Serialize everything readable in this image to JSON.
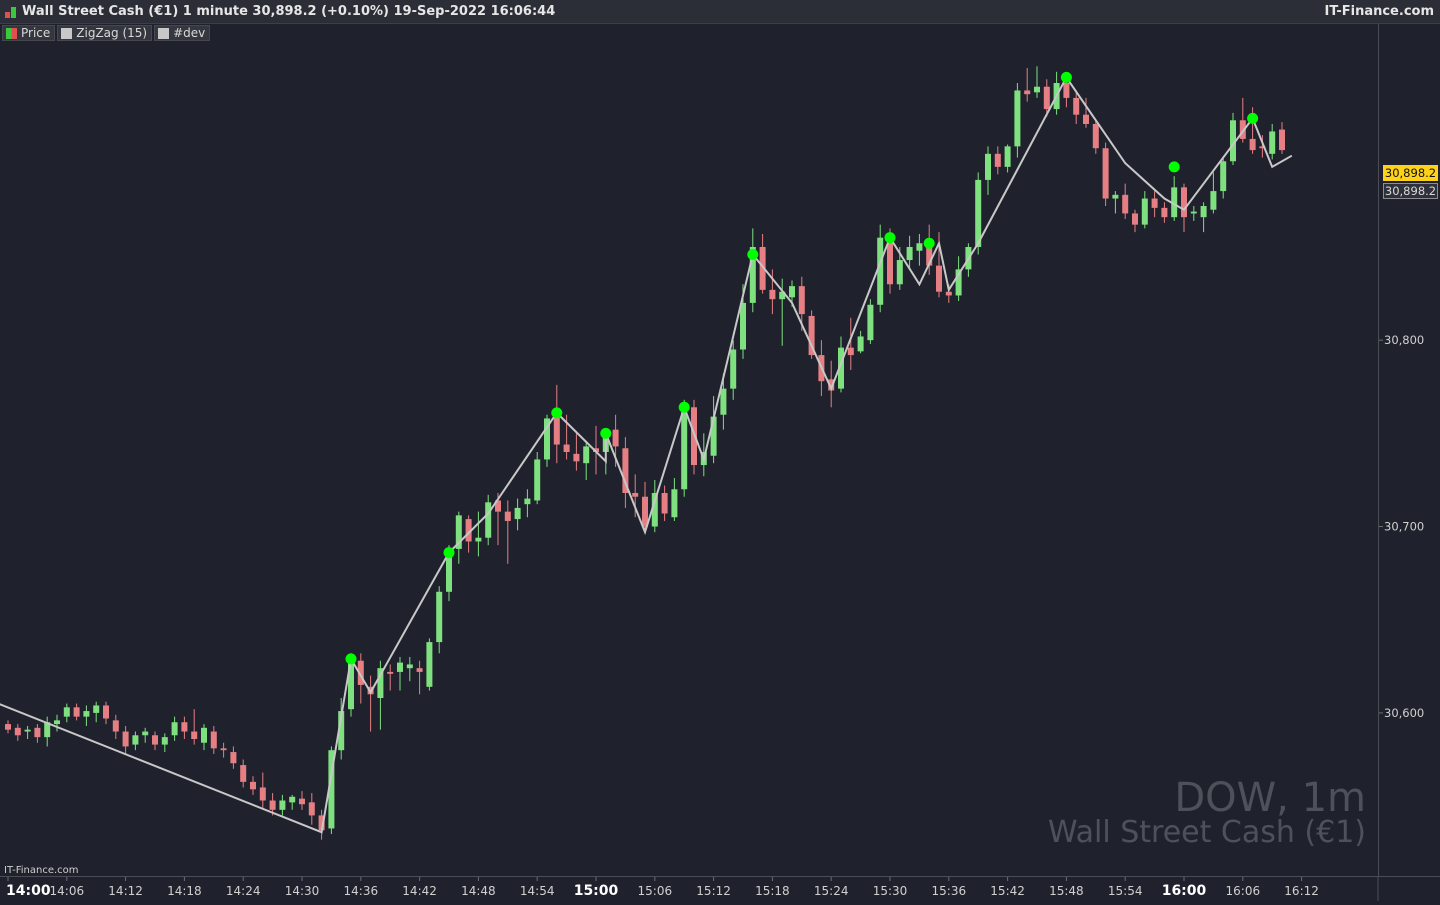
{
  "header": {
    "title": "Wall Street Cash (€1) 1 minute 30,898.2 (+0.10%) 19-Sep-2022 16:06:44",
    "brand": "IT-Finance.com"
  },
  "legend": [
    {
      "label": "Price",
      "swatch": "price-icon"
    },
    {
      "label": "ZigZag (15)",
      "swatch": "#c8c8c8"
    },
    {
      "label": "#dev",
      "swatch": "#c8c8c8"
    }
  ],
  "watermark": {
    "symbol": "DOW, 1m",
    "name": "Wall Street Cash (€1)"
  },
  "footer": {
    "brand": "IT-Finance.com"
  },
  "price_tags": {
    "last": "30,898.2",
    "close": "30,898.2"
  },
  "colors": {
    "up": "#7fe07f",
    "down": "#e57f84",
    "zigzag": "#c8c8c8",
    "pivot": "#00ff00",
    "tag": "#ffd21a"
  },
  "chart_data": {
    "type": "candlestick",
    "title": "Wall Street Cash (€1) 1 minute",
    "ylim": [
      30520,
      30960
    ],
    "y_ticks": [
      {
        "v": 30600,
        "label": "30,600"
      },
      {
        "v": 30700,
        "label": "30,700"
      },
      {
        "v": 30800,
        "label": "30,800"
      }
    ],
    "x_ticks": [
      {
        "i": 0,
        "label": "14:00",
        "bold": true
      },
      {
        "i": 6,
        "label": "14:06"
      },
      {
        "i": 12,
        "label": "14:12"
      },
      {
        "i": 18,
        "label": "14:18"
      },
      {
        "i": 24,
        "label": "14:24"
      },
      {
        "i": 30,
        "label": "14:30"
      },
      {
        "i": 36,
        "label": "14:36"
      },
      {
        "i": 42,
        "label": "14:42"
      },
      {
        "i": 48,
        "label": "14:48"
      },
      {
        "i": 54,
        "label": "14:54"
      },
      {
        "i": 60,
        "label": "15:00",
        "bold": true
      },
      {
        "i": 66,
        "label": "15:06"
      },
      {
        "i": 72,
        "label": "15:12"
      },
      {
        "i": 78,
        "label": "15:18"
      },
      {
        "i": 84,
        "label": "15:24"
      },
      {
        "i": 90,
        "label": "15:30"
      },
      {
        "i": 96,
        "label": "15:36"
      },
      {
        "i": 102,
        "label": "15:42"
      },
      {
        "i": 108,
        "label": "15:48"
      },
      {
        "i": 114,
        "label": "15:54"
      },
      {
        "i": 120,
        "label": "16:00",
        "bold": true
      },
      {
        "i": 126,
        "label": "16:06"
      },
      {
        "i": 132,
        "label": "16:12"
      }
    ],
    "ohlc": [
      [
        30594,
        30596,
        30589,
        30591
      ],
      [
        30592,
        30594,
        30585,
        30588
      ],
      [
        30590,
        30593,
        30586,
        30591
      ],
      [
        30592,
        30594,
        30584,
        30587
      ],
      [
        30587,
        30598,
        30582,
        30595
      ],
      [
        30594,
        30599,
        30590,
        30596
      ],
      [
        30598,
        30605,
        30595,
        30603
      ],
      [
        30603,
        30605,
        30596,
        30598
      ],
      [
        30598,
        30604,
        30593,
        30601
      ],
      [
        30600,
        30606,
        30595,
        30604
      ],
      [
        30604,
        30606,
        30594,
        30597
      ],
      [
        30596,
        30599,
        30586,
        30590
      ],
      [
        30590,
        30593,
        30578,
        30582
      ],
      [
        30583,
        30590,
        30580,
        30588
      ],
      [
        30588,
        30592,
        30584,
        30590
      ],
      [
        30588,
        30590,
        30580,
        30583
      ],
      [
        30583,
        30589,
        30579,
        30587
      ],
      [
        30588,
        30598,
        30585,
        30595
      ],
      [
        30595,
        30598,
        30586,
        30590
      ],
      [
        30590,
        30602,
        30583,
        30586
      ],
      [
        30584,
        30594,
        30580,
        30592
      ],
      [
        30590,
        30593,
        30578,
        30581
      ],
      [
        30581,
        30584,
        30576,
        30580
      ],
      [
        30579,
        30582,
        30570,
        30573
      ],
      [
        30572,
        30575,
        30560,
        30563
      ],
      [
        30563,
        30566,
        30556,
        30559
      ],
      [
        30560,
        30568,
        30548,
        30553
      ],
      [
        30553,
        30557,
        30545,
        30548
      ],
      [
        30548,
        30556,
        30545,
        30553
      ],
      [
        30552,
        30556,
        30548,
        30555
      ],
      [
        30554,
        30558,
        30548,
        30551
      ],
      [
        30552,
        30557,
        30540,
        30545
      ],
      [
        30545,
        30548,
        30532,
        30537
      ],
      [
        30538,
        30582,
        30535,
        30580
      ],
      [
        30580,
        30608,
        30575,
        30601
      ],
      [
        30602,
        30632,
        30598,
        30630
      ],
      [
        30628,
        30632,
        30605,
        30615
      ],
      [
        30614,
        30620,
        30590,
        30610
      ],
      [
        30608,
        30628,
        30591,
        30624
      ],
      [
        30622,
        30626,
        30612,
        30621
      ],
      [
        30622,
        30630,
        30612,
        30627
      ],
      [
        30624,
        30630,
        30617,
        30626
      ],
      [
        30624,
        30628,
        30610,
        30622
      ],
      [
        30614,
        30640,
        30612,
        30638
      ],
      [
        30638,
        30668,
        30632,
        30665
      ],
      [
        30665,
        30690,
        30660,
        30686
      ],
      [
        30688,
        30708,
        30680,
        30706
      ],
      [
        30704,
        30706,
        30686,
        30692
      ],
      [
        30692,
        30708,
        30684,
        30694
      ],
      [
        30694,
        30717,
        30690,
        30713
      ],
      [
        30714,
        30718,
        30690,
        30708
      ],
      [
        30708,
        30714,
        30680,
        30703
      ],
      [
        30704,
        30715,
        30698,
        30710
      ],
      [
        30712,
        30720,
        30705,
        30715
      ],
      [
        30714,
        30740,
        30712,
        30736
      ],
      [
        30736,
        30760,
        30732,
        30758
      ],
      [
        30760,
        30776,
        30734,
        30744
      ],
      [
        30744,
        30760,
        30736,
        30740
      ],
      [
        30739,
        30750,
        30730,
        30735
      ],
      [
        30734,
        30746,
        30725,
        30743
      ],
      [
        30742,
        30754,
        30728,
        30740
      ],
      [
        30740,
        30750,
        30728,
        30752
      ],
      [
        30752,
        30760,
        30732,
        30743
      ],
      [
        30742,
        30748,
        30710,
        30718
      ],
      [
        30718,
        30728,
        30705,
        30716
      ],
      [
        30716,
        30724,
        30698,
        30700
      ],
      [
        30700,
        30725,
        30697,
        30718
      ],
      [
        30718,
        30722,
        30703,
        30707
      ],
      [
        30705,
        30726,
        30703,
        30720
      ],
      [
        30720,
        30768,
        30716,
        30764
      ],
      [
        30764,
        30768,
        30728,
        30733
      ],
      [
        30733,
        30750,
        30727,
        30740
      ],
      [
        30738,
        30770,
        30734,
        30759
      ],
      [
        30760,
        30782,
        30752,
        30774
      ],
      [
        30774,
        30800,
        30768,
        30795
      ],
      [
        30795,
        30830,
        30790,
        30820
      ],
      [
        30820,
        30860,
        30815,
        30850
      ],
      [
        30850,
        30857,
        30825,
        30827
      ],
      [
        30827,
        30838,
        30814,
        30822
      ],
      [
        30822,
        30833,
        30797,
        30826
      ],
      [
        30823,
        30832,
        30818,
        30829
      ],
      [
        30829,
        30834,
        30805,
        30814
      ],
      [
        30813,
        30816,
        30790,
        30792
      ],
      [
        30792,
        30800,
        30770,
        30778
      ],
      [
        30779,
        30789,
        30764,
        30773
      ],
      [
        30774,
        30802,
        30772,
        30796
      ],
      [
        30796,
        30812,
        30784,
        30792
      ],
      [
        30794,
        30805,
        30793,
        30802
      ],
      [
        30800,
        30822,
        30798,
        30819
      ],
      [
        30819,
        30862,
        30815,
        30855
      ],
      [
        30855,
        30860,
        30825,
        30830
      ],
      [
        30830,
        30850,
        30827,
        30843
      ],
      [
        30843,
        30856,
        30838,
        30850
      ],
      [
        30848,
        30857,
        30840,
        30852
      ],
      [
        30852,
        30862,
        30835,
        30840
      ],
      [
        30840,
        30858,
        30823,
        30826
      ],
      [
        30826,
        30830,
        30820,
        30824
      ],
      [
        30824,
        30845,
        30821,
        30838
      ],
      [
        30838,
        30852,
        30834,
        30850
      ],
      [
        30850,
        30890,
        30846,
        30886
      ],
      [
        30886,
        30904,
        30878,
        30900
      ],
      [
        30900,
        30904,
        30889,
        30893
      ],
      [
        30893,
        30905,
        30890,
        30904
      ],
      [
        30904,
        30938,
        30898,
        30934
      ],
      [
        30934,
        30946,
        30928,
        30932
      ],
      [
        30933,
        30947,
        30930,
        30936
      ],
      [
        30936,
        30940,
        30920,
        30924
      ],
      [
        30924,
        30944,
        30921,
        30938
      ],
      [
        30938,
        30944,
        30925,
        30930
      ],
      [
        30930,
        30934,
        30916,
        30921
      ],
      [
        30921,
        30930,
        30914,
        30916
      ],
      [
        30916,
        30918,
        30900,
        30903
      ],
      [
        30903,
        30906,
        30872,
        30876
      ],
      [
        30876,
        30880,
        30868,
        30878
      ],
      [
        30878,
        30884,
        30865,
        30868
      ],
      [
        30868,
        30870,
        30858,
        30862
      ],
      [
        30862,
        30880,
        30860,
        30876
      ],
      [
        30876,
        30880,
        30866,
        30871
      ],
      [
        30871,
        30874,
        30863,
        30866
      ],
      [
        30866,
        30888,
        30864,
        30882
      ],
      [
        30882,
        30884,
        30858,
        30866
      ],
      [
        30868,
        30872,
        30864,
        30869
      ],
      [
        30866,
        30874,
        30858,
        30872
      ],
      [
        30870,
        30890,
        30868,
        30880
      ],
      [
        30880,
        30898,
        30876,
        30896
      ],
      [
        30896,
        30922,
        30894,
        30918
      ],
      [
        30918,
        30930,
        30906,
        30908
      ],
      [
        30908,
        30925,
        30900,
        30902
      ],
      [
        30904,
        30910,
        30898,
        30903
      ],
      [
        30900,
        30916,
        30897,
        30912
      ],
      [
        30913,
        30917,
        30900,
        30902
      ]
    ],
    "zigzag": [
      [
        -1,
        30605
      ],
      [
        32,
        30536
      ],
      [
        35,
        30629
      ],
      [
        37,
        30611
      ],
      [
        45,
        30686
      ],
      [
        49,
        30707
      ],
      [
        56,
        30761
      ],
      [
        61,
        30735
      ],
      [
        61,
        30750
      ],
      [
        65,
        30697
      ],
      [
        69,
        30764
      ],
      [
        71,
        30736
      ],
      [
        76,
        30846
      ],
      [
        80,
        30820
      ],
      [
        84,
        30774
      ],
      [
        90,
        30855
      ],
      [
        93,
        30830
      ],
      [
        95,
        30852
      ],
      [
        96,
        30827
      ],
      [
        99,
        30852
      ],
      [
        108,
        30941
      ],
      [
        114,
        30895
      ],
      [
        118,
        30876
      ],
      [
        120,
        30870
      ],
      [
        127,
        30919
      ],
      [
        129,
        30893
      ],
      [
        131,
        30899
      ]
    ],
    "pivots": [
      [
        35,
        30629
      ],
      [
        45,
        30686
      ],
      [
        56,
        30761
      ],
      [
        61,
        30750
      ],
      [
        69,
        30764
      ],
      [
        76,
        30846
      ],
      [
        90,
        30855
      ],
      [
        94,
        30852
      ],
      [
        108,
        30941
      ],
      [
        119,
        30893
      ],
      [
        127,
        30919
      ]
    ]
  }
}
